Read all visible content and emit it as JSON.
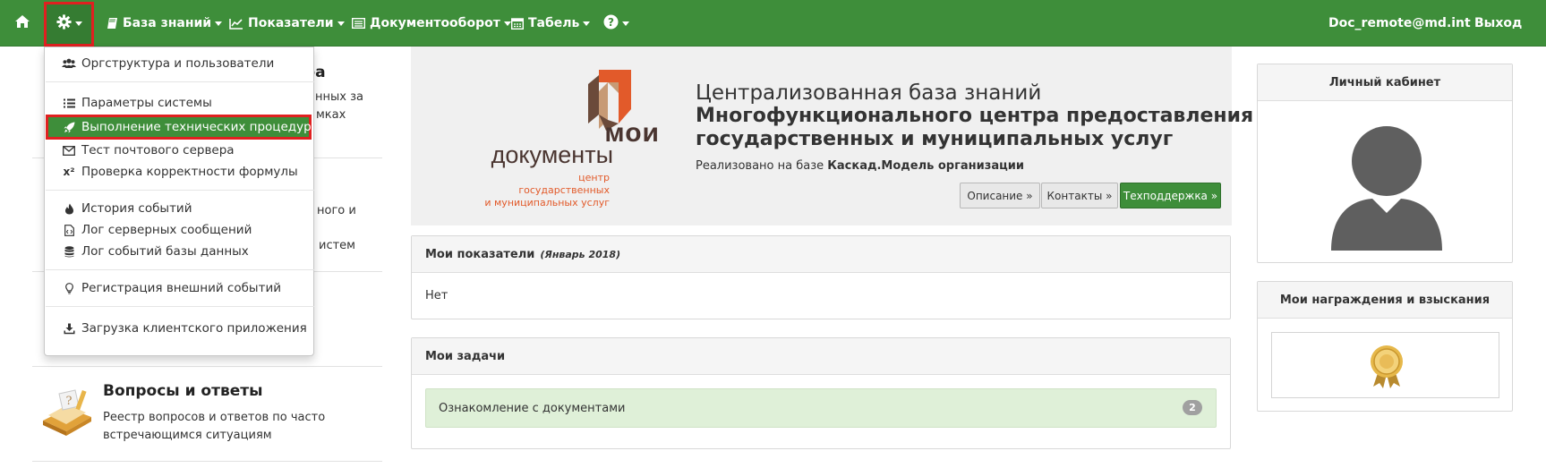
{
  "navbar": {
    "items": [
      {
        "label": "База знаний",
        "icon": "book-icon"
      },
      {
        "label": "Показатели",
        "icon": "line-chart-icon"
      },
      {
        "label": "Документооборот",
        "icon": "list-alt-icon"
      },
      {
        "label": "Табель",
        "icon": "calendar-icon"
      }
    ],
    "user": "Doc_remote@md.int",
    "logout": "Выход",
    "colors": {
      "bar": "#3e8e3a",
      "highlight": "#e02020"
    }
  },
  "admin_menu": {
    "items": [
      {
        "label": "Оргструктура и пользователи",
        "icon": "users-icon"
      },
      {
        "label": "Параметры системы",
        "icon": "list-icon"
      },
      {
        "label": "Выполнение технических процедур",
        "icon": "rocket-icon",
        "active": true
      },
      {
        "label": "Тест почтового сервера",
        "icon": "envelope-icon"
      },
      {
        "label": "Проверка корректности формулы",
        "icon": "superscript-icon"
      },
      {
        "label": "История событий",
        "icon": "fire-icon"
      },
      {
        "label": "Лог серверных сообщений",
        "icon": "file-code-icon"
      },
      {
        "label": "Лог событий базы данных",
        "icon": "database-icon"
      },
      {
        "label": "Регистрация внешний событий",
        "icon": "lightbulb-icon"
      },
      {
        "label": "Загрузка клиентского приложения",
        "icon": "download-icon"
      }
    ]
  },
  "sidebar": {
    "fragments": {
      "f1": "ра",
      "f2": "нных за",
      "f3": "мках",
      "f4": "ного и",
      "f5": "истем"
    },
    "qa": {
      "title": "Вопросы и ответы",
      "desc_line1": "Реестр вопросов и ответов по часто",
      "desc_line2": "встречающимся ситуациям"
    }
  },
  "banner": {
    "logo": {
      "word1": "мои",
      "word2": "документы",
      "sub1": "центр",
      "sub2": "государственных",
      "sub3": "и муниципальных услуг"
    },
    "title_line1": "Централизованная база знаний",
    "title_line2": "Многофункционального центра предоставления",
    "title_line3": "государственных и муниципальных услуг",
    "realized_prefix": "Реализовано на базе",
    "realized_bold": "Каскад.Модель организации",
    "buttons": {
      "description": "Описание »",
      "contacts": "Контакты »",
      "support": "Техподдержка »"
    }
  },
  "panels": {
    "indicators": {
      "title": "Мои показатели",
      "period": "(Январь 2018)",
      "body": "Нет"
    },
    "tasks": {
      "title": "Мои задачи",
      "item": "Ознакомление с документами",
      "count": "2"
    },
    "cabinet": {
      "title": "Личный кабинет"
    },
    "awards": {
      "title": "Мои награждения и взыскания"
    }
  }
}
